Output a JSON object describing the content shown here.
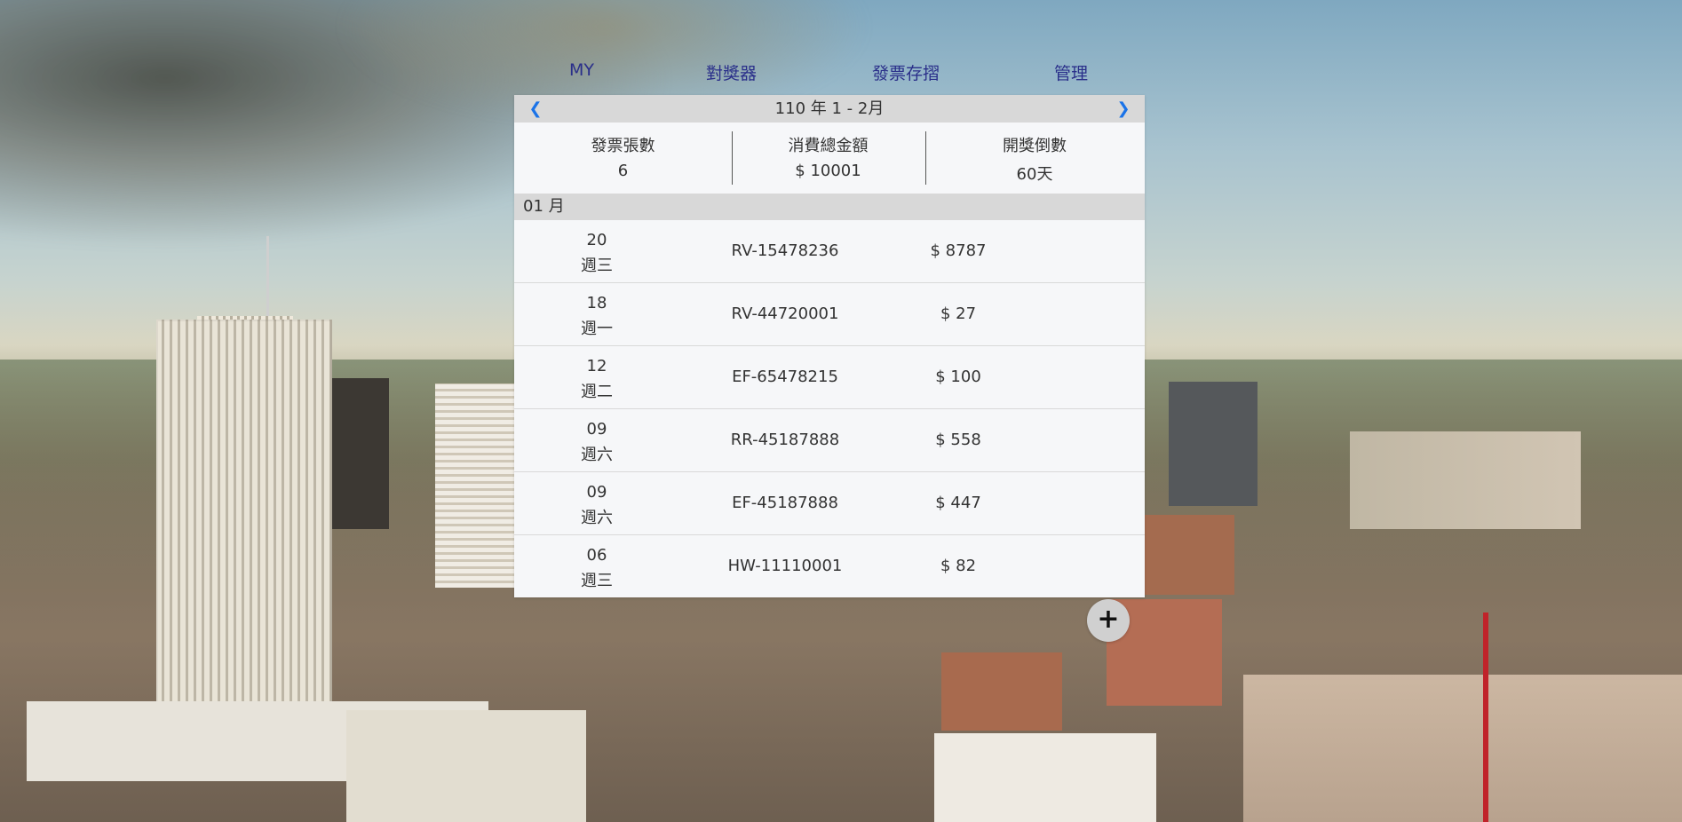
{
  "nav": {
    "items": [
      {
        "label": "MY"
      },
      {
        "label": "對獎器"
      },
      {
        "label": "發票存摺"
      },
      {
        "label": "管理"
      }
    ],
    "color": "#2a2f8a"
  },
  "period": {
    "label": "110 年 1 - 2月",
    "prev_icon": "chevron-left-icon",
    "next_icon": "chevron-right-icon",
    "arrow_color": "#1a73e8"
  },
  "stats": {
    "count_label": "發票張數",
    "count_value": "6",
    "total_label": "消費總金額",
    "total_value": "$ 10001",
    "days_label": "開獎倒數",
    "days_value": "60天"
  },
  "month": {
    "label": "01 月"
  },
  "invoices": [
    {
      "day": "20",
      "weekday": "週三",
      "number": "RV-15478236",
      "amount": "$ 8787"
    },
    {
      "day": "18",
      "weekday": "週一",
      "number": "RV-44720001",
      "amount": "$ 27"
    },
    {
      "day": "12",
      "weekday": "週二",
      "number": "EF-65478215",
      "amount": "$ 100"
    },
    {
      "day": "09",
      "weekday": "週六",
      "number": "RR-45187888",
      "amount": "$ 558"
    },
    {
      "day": "09",
      "weekday": "週六",
      "number": "EF-45187888",
      "amount": "$ 447"
    },
    {
      "day": "06",
      "weekday": "週三",
      "number": "HW-11110001",
      "amount": "$ 82"
    }
  ],
  "fab": {
    "label": "+",
    "icon": "plus-icon"
  }
}
